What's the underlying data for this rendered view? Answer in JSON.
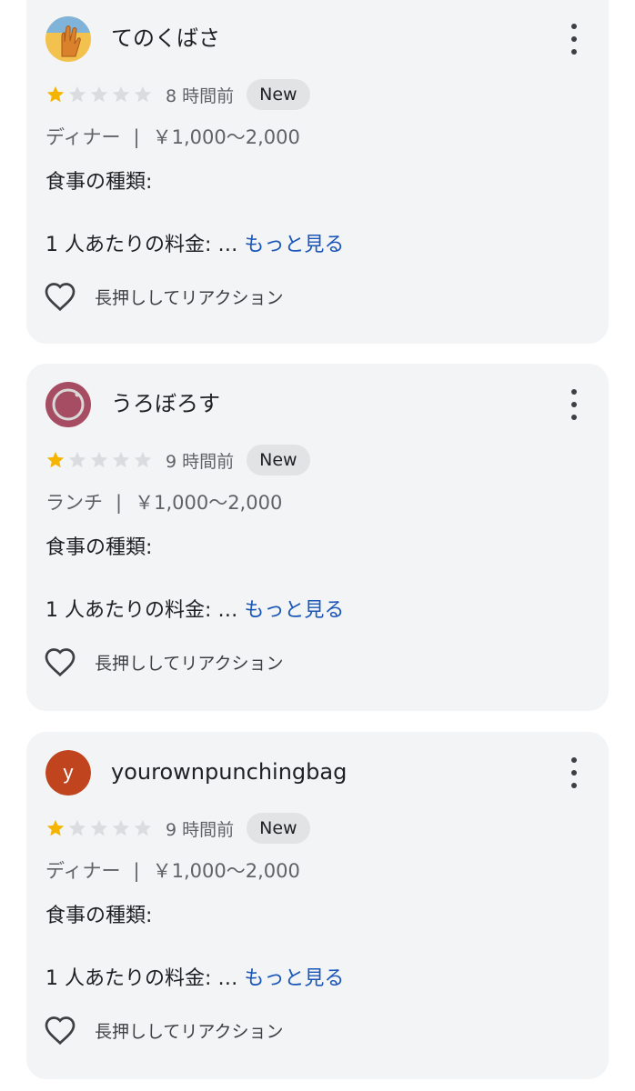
{
  "reviews": [
    {
      "username": "てのくばさ",
      "avatar_type": "image",
      "avatar_colors": {
        "bg": "#f2c14e",
        "accent": "#d9822b"
      },
      "rating": 1,
      "max_rating": 5,
      "time": "8 時間前",
      "badge": "New",
      "meal": "ディナー",
      "separator": "|",
      "price_range": "￥1,000〜2,000",
      "food_type_label": "食事の種類:",
      "price_per_person_label": "1 人あたりの料金: …",
      "more_label": "もっと見る",
      "reaction_label": "長押ししてリアクション"
    },
    {
      "username": "うろぼろす",
      "avatar_type": "image",
      "avatar_colors": {
        "bg": "#a64d63",
        "accent": "#d9d9d9"
      },
      "rating": 1,
      "max_rating": 5,
      "time": "9 時間前",
      "badge": "New",
      "meal": "ランチ",
      "separator": "|",
      "price_range": "￥1,000〜2,000",
      "food_type_label": "食事の種類:",
      "price_per_person_label": "1 人あたりの料金: …",
      "more_label": "もっと見る",
      "reaction_label": "長押ししてリアクション"
    },
    {
      "username": "yourownpunchingbag",
      "avatar_type": "letter",
      "avatar_letter": "y",
      "avatar_colors": {
        "bg": "#c0451f",
        "accent": "#ffffff"
      },
      "rating": 1,
      "max_rating": 5,
      "time": "9 時間前",
      "badge": "New",
      "meal": "ディナー",
      "separator": "|",
      "price_range": "￥1,000〜2,000",
      "food_type_label": "食事の種類:",
      "price_per_person_label": "1 人あたりの料金: …",
      "more_label": "もっと見る",
      "reaction_label": "長押ししてリアクション"
    }
  ],
  "colors": {
    "star_filled": "#f4b400",
    "star_empty": "#dadce0",
    "link": "#1a56b8",
    "card_bg": "#f3f4f6"
  },
  "icons": {
    "more": "more-vert-icon",
    "reaction": "heart-outline-icon",
    "star": "star-icon"
  }
}
